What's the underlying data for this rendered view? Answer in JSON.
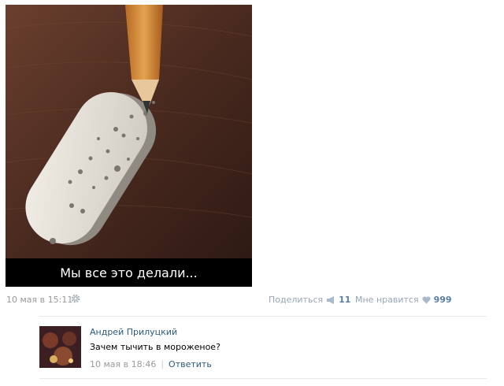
{
  "post": {
    "image_caption": "Мы все это делали...",
    "date": "10 мая в 15:11",
    "share_label": "Поделиться",
    "share_count": "11",
    "like_label": "Мне нравится",
    "like_count": "999"
  },
  "comment": {
    "author": "Андрей Прилуцкий",
    "text": "Зачем тычить в мороженое?",
    "date": "10 мая в 18:46",
    "separator": "|",
    "reply_label": "Ответить"
  },
  "colors": {
    "link": "#2b587a",
    "muted": "#999999",
    "action": "#99a6b6",
    "count": "#597da3"
  },
  "icons": {
    "settings": "gear-icon",
    "share": "megaphone-icon",
    "like": "heart-icon"
  }
}
